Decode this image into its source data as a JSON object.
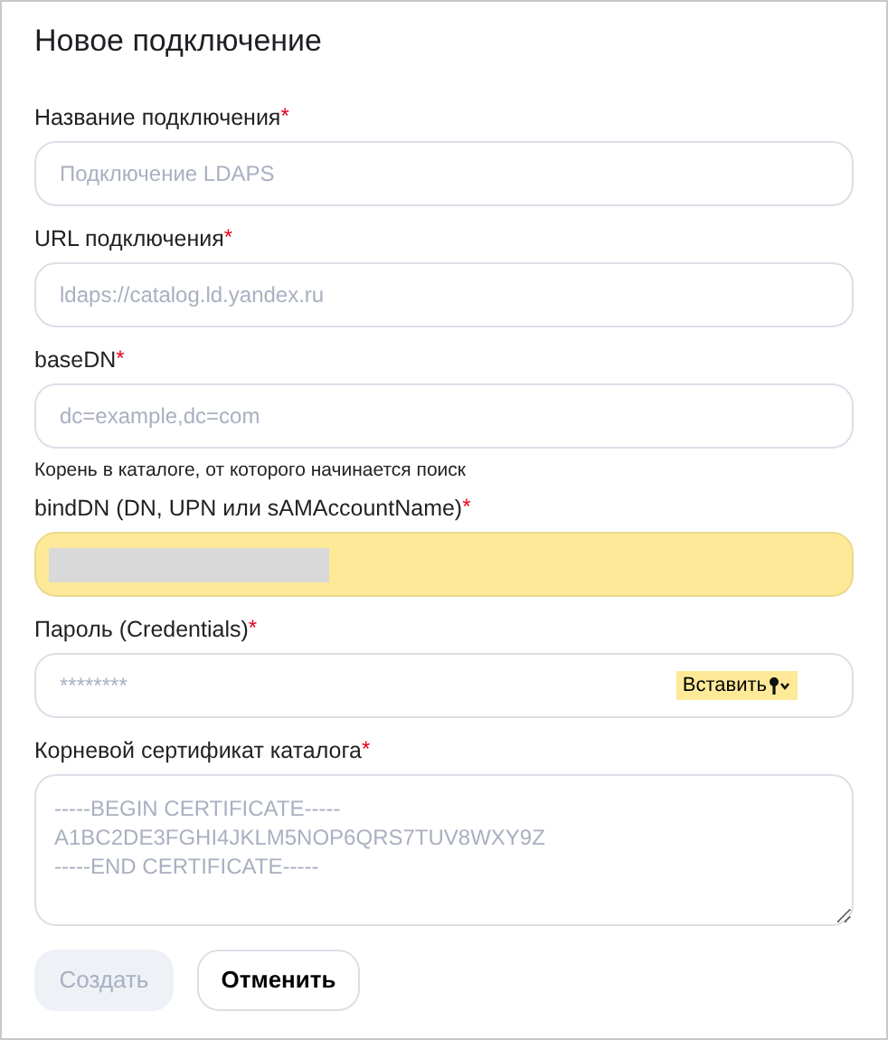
{
  "dialog": {
    "title": "Новое подключение"
  },
  "fields": [
    {
      "kind": "text",
      "label": "Название подключения",
      "required_mark": "*",
      "placeholder": "Подключение LDAPS",
      "autofilled": false
    },
    {
      "kind": "text",
      "label": "URL подключения",
      "required_mark": "*",
      "placeholder": "ldaps://catalog.ld.yandex.ru",
      "autofilled": false
    },
    {
      "kind": "text",
      "label": "baseDN",
      "required_mark": "*",
      "placeholder": "dc=example,dc=com",
      "hint": "Корень в каталоге, от которого начинается поиск",
      "autofilled": false
    },
    {
      "kind": "text",
      "label": "bindDN (DN, UPN или sAMAccountName)",
      "required_mark": "*",
      "autofilled": true,
      "redacted": true
    },
    {
      "kind": "password",
      "label": "Пароль (Credentials)",
      "required_mark": "*",
      "placeholder": "********",
      "paste_button": "Вставить",
      "autofilled": false
    },
    {
      "kind": "textarea",
      "label": "Корневой сертификат каталога",
      "required_mark": "*",
      "placeholder": "-----BEGIN CERTIFICATE-----\nA1BC2DE3FGHI4JKLM5NOP6QRS7TUV8WXY9Z\n-----END CERTIFICATE-----",
      "autofilled": false
    }
  ],
  "buttons": [
    {
      "label": "Создать",
      "kind": "primary",
      "disabled": true
    },
    {
      "label": "Отменить",
      "kind": "secondary",
      "disabled": false
    }
  ]
}
